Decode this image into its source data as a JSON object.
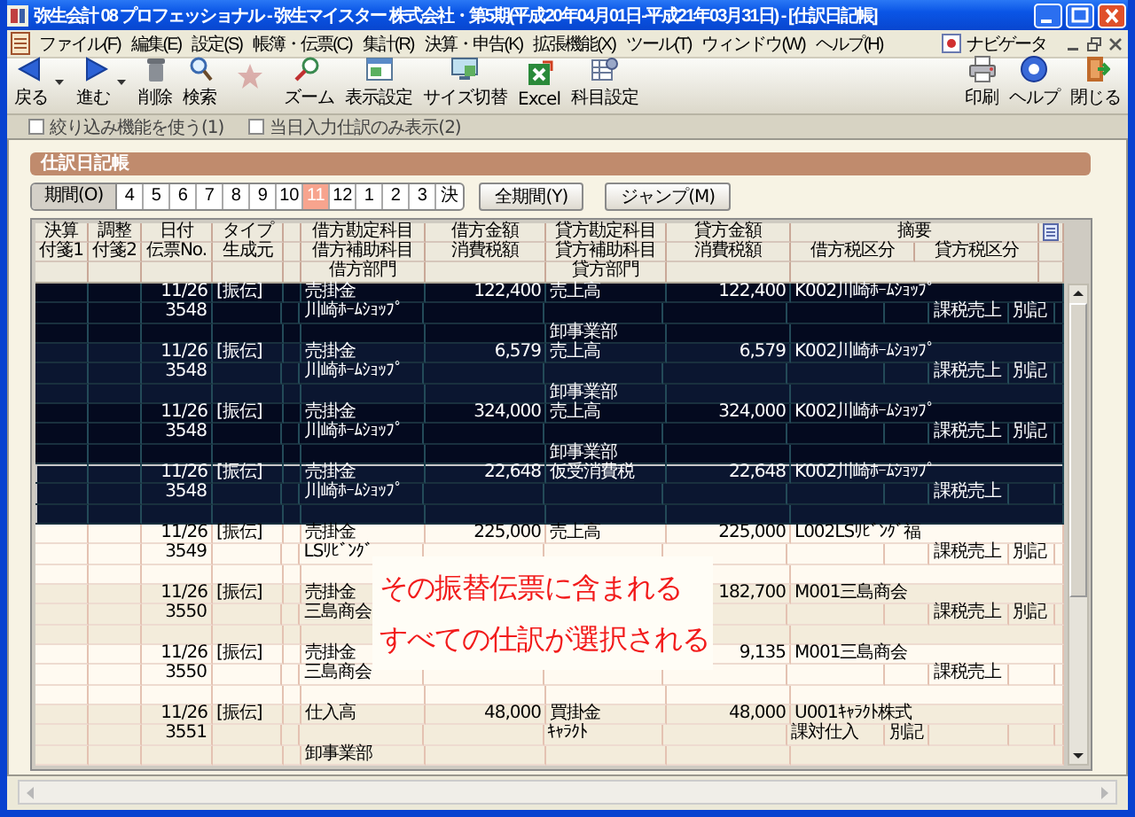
{
  "window": {
    "title": "弥生会計 08 プロフェッショナル - 弥生マイスター 株式会社・第5期(平成20年04月01日-平成21年03月31日) - [仕訳日記帳]"
  },
  "menu": [
    "ファイル(F)",
    "編集(E)",
    "設定(S)",
    "帳簿・伝票(C)",
    "集計(R)",
    "決算・申告(K)",
    "拡張機能(X)",
    "ツール(T)",
    "ウィンドウ(W)",
    "ヘルプ(H)"
  ],
  "navigator": {
    "label": "ナビゲータ"
  },
  "toolbar": [
    {
      "kind": "back",
      "label": "戻る",
      "dropdown": true,
      "disabled": false
    },
    {
      "kind": "forward",
      "label": "進む",
      "dropdown": true,
      "disabled": false
    },
    {
      "kind": "delete",
      "label": "削除",
      "dropdown": false,
      "disabled": false
    },
    {
      "kind": "search",
      "label": "検索",
      "dropdown": false,
      "disabled": false
    },
    {
      "kind": "switch",
      "dropdown": false,
      "disabled": true
    },
    {
      "kind": "zoom",
      "label": "ズーム",
      "dropdown": false,
      "disabled": false
    },
    {
      "kind": "display",
      "label": "表示設定",
      "dropdown": false,
      "disabled": false
    },
    {
      "kind": "size",
      "label": "サイズ切替",
      "dropdown": false,
      "disabled": false
    },
    {
      "kind": "excel",
      "label": "Excel",
      "dropdown": false,
      "disabled": false
    },
    {
      "kind": "accounts",
      "label": "科目設定",
      "dropdown": false,
      "disabled": false
    }
  ],
  "toolbar_right": [
    {
      "kind": "print",
      "label": "印刷"
    },
    {
      "kind": "help",
      "label": "ヘルプ"
    },
    {
      "kind": "close",
      "label": "閉じる"
    }
  ],
  "filters": [
    {
      "label": "絞り込み機能を使う(1)",
      "checked": false
    },
    {
      "label": "当日入力仕訳のみ表示(2)",
      "checked": false
    }
  ],
  "panel": {
    "title": "仕訳日記帳"
  },
  "period": {
    "label": "期間(O)",
    "months": [
      {
        "label": "4",
        "selected": false
      },
      {
        "label": "5",
        "selected": false
      },
      {
        "label": "6",
        "selected": false
      },
      {
        "label": "7",
        "selected": false
      },
      {
        "label": "8",
        "selected": false
      },
      {
        "label": "9",
        "selected": false
      },
      {
        "label": "10",
        "selected": false
      },
      {
        "label": "11",
        "selected": true
      },
      {
        "label": "12",
        "selected": false
      },
      {
        "label": "1",
        "selected": false
      },
      {
        "label": "2",
        "selected": false
      },
      {
        "label": "3",
        "selected": false
      },
      {
        "label": "決",
        "selected": false
      }
    ],
    "buttons": [
      "全期間(Y)",
      "ジャンプ(M)"
    ]
  },
  "table": {
    "header": {
      "line_1": [
        "決算",
        "調整",
        "日付",
        "タイプ",
        "借方勘定科目",
        "借方金額",
        "貸方勘定科目",
        "貸方金額",
        "摘要"
      ],
      "line_2": [
        "付箋1",
        "付箋2",
        "伝票No.",
        "生成元",
        "借方補助科目",
        "消費税額",
        "貸方補助科目",
        "消費税額",
        "借方税区分",
        "貸方税区分"
      ],
      "line_3": [
        "借方部門",
        "貸方部門"
      ]
    },
    "entries": [
      {
        "date": "11/26",
        "type": "[振伝]",
        "debit_account": "売掛金",
        "debit_amount": "122,400",
        "credit_account": "売上高",
        "credit_amount": "122,400",
        "description": "K002川崎ﾎｰﾑｼｮｯﾌﾟ",
        "voucher_no": "3548",
        "debit_sub": "川崎ﾎｰﾑｼｮｯﾌﾟ",
        "credit_tax": "課税売上",
        "credit_tax_note": "別記",
        "credit_dept": "卸事業部",
        "selected": true,
        "focused": false
      },
      {
        "date": "11/26",
        "type": "[振伝]",
        "debit_account": "売掛金",
        "debit_amount": "6,579",
        "credit_account": "売上高",
        "credit_amount": "6,579",
        "description": "K002川崎ﾎｰﾑｼｮｯﾌﾟ",
        "voucher_no": "3548",
        "debit_sub": "川崎ﾎｰﾑｼｮｯﾌﾟ",
        "credit_tax": "課税売上",
        "credit_tax_note": "別記",
        "credit_dept": "卸事業部",
        "selected": true,
        "focused": false
      },
      {
        "date": "11/26",
        "type": "[振伝]",
        "debit_account": "売掛金",
        "debit_amount": "324,000",
        "credit_account": "売上高",
        "credit_amount": "324,000",
        "description": "K002川崎ﾎｰﾑｼｮｯﾌﾟ",
        "voucher_no": "3548",
        "debit_sub": "川崎ﾎｰﾑｼｮｯﾌﾟ",
        "credit_tax": "課税売上",
        "credit_tax_note": "別記",
        "credit_dept": "卸事業部",
        "selected": true,
        "focused": false
      },
      {
        "date": "11/26",
        "type": "[振伝]",
        "debit_account": "売掛金",
        "debit_amount": "22,648",
        "credit_account": "仮受消費税",
        "credit_amount": "22,648",
        "description": "K002川崎ﾎｰﾑｼｮｯﾌﾟ",
        "voucher_no": "3548",
        "debit_sub": "川崎ﾎｰﾑｼｮｯﾌﾟ",
        "credit_tax": "課税売上",
        "selected": true,
        "focused": true
      },
      {
        "date": "11/26",
        "type": "[振伝]",
        "debit_account": "売掛金",
        "debit_amount": "225,000",
        "credit_account": "売上高",
        "credit_amount": "225,000",
        "description": "L002LSﾘﾋﾞﾝｸﾞ福",
        "voucher_no": "3549",
        "debit_sub": "LSﾘﾋﾞﾝｸﾞ",
        "credit_tax": "課税売上",
        "credit_tax_note": "別記",
        "selected": false,
        "focused": false
      },
      {
        "date": "11/26",
        "type": "[振伝]",
        "debit_account": "売掛金",
        "credit_amount": "182,700",
        "description": "M001三島商会",
        "voucher_no": "3550",
        "debit_sub": "三島商会",
        "credit_tax": "課税売上",
        "credit_tax_note": "別記",
        "selected": false,
        "focused": false
      },
      {
        "date": "11/26",
        "type": "[振伝]",
        "debit_account": "売掛金",
        "credit_amount": "9,135",
        "description": "M001三島商会",
        "voucher_no": "3550",
        "debit_sub": "三島商会",
        "credit_tax": "課税売上",
        "selected": false,
        "focused": false
      },
      {
        "date": "11/26",
        "type": "[振伝]",
        "debit_account": "仕入高",
        "debit_amount": "48,000",
        "credit_account": "買掛金",
        "credit_amount": "48,000",
        "description": "U001ｷｬﾗｸﾄ株式",
        "voucher_no": "3551",
        "credit_sub": "ｷｬﾗｸﾄ",
        "debit_tax": "課対仕入",
        "debit_tax_note": "別記",
        "debit_dept": "卸事業部",
        "selected": false,
        "focused": false
      }
    ]
  },
  "callout": {
    "lines": [
      "その振替伝票に含まれる",
      "すべての仕訳が選択される"
    ]
  }
}
